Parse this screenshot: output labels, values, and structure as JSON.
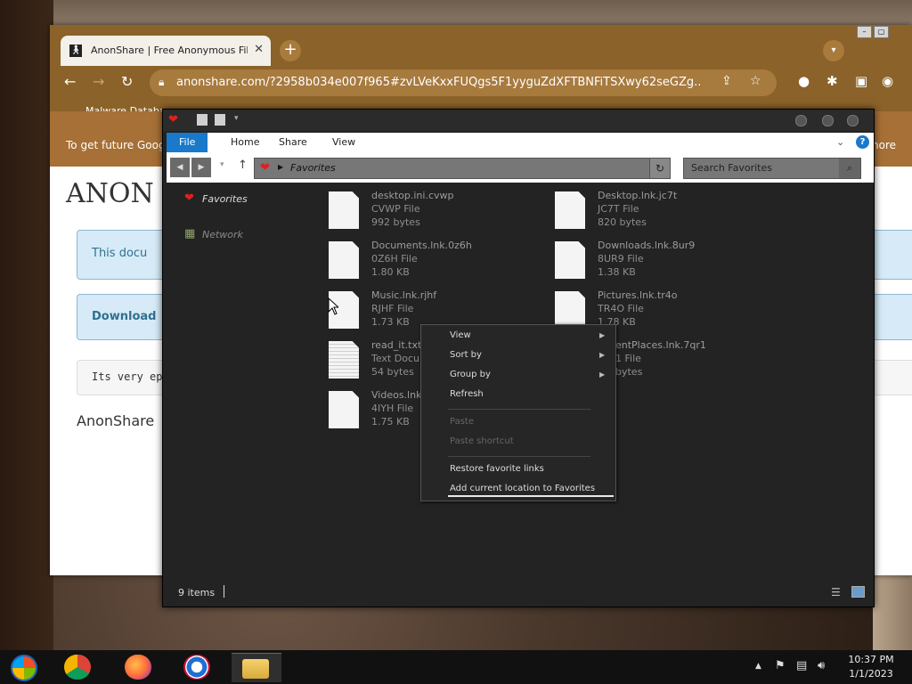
{
  "chrome": {
    "tab_title": "AnonShare | Free Anonymous File Sharing",
    "url": "anonshare.com/?2958b034e007f965#zvLVeKxxFUQgs5F1yyguZdXFTBNFiTSXwy62seGZg...",
    "bookmark_label": "Malware Databas",
    "banner_left": "To get future Goog",
    "banner_right": "more"
  },
  "page": {
    "logo": "ANON",
    "panel1_text": "This docu",
    "panel2_text": "Download",
    "panel3_text": "Its very ep",
    "footer_text": "AnonShare"
  },
  "explorer": {
    "ribbon_tabs": [
      "File",
      "Home",
      "Share",
      "View"
    ],
    "address": "Favorites",
    "search_placeholder": "Search Favorites",
    "nav": [
      {
        "label": "Favorites",
        "icon": "heart-icon"
      },
      {
        "label": "Network",
        "icon": "network-icon"
      }
    ],
    "files": [
      {
        "name": "desktop.ini.cvwp",
        "type": "CVWP File",
        "size": "992 bytes"
      },
      {
        "name": "Desktop.lnk.jc7t",
        "type": "JC7T File",
        "size": "820 bytes"
      },
      {
        "name": "Documents.lnk.0z6h",
        "type": "0Z6H File",
        "size": "1.80 KB"
      },
      {
        "name": "Downloads.lnk.8ur9",
        "type": "8UR9 File",
        "size": "1.38 KB"
      },
      {
        "name": "Music.lnk.rjhf",
        "type": "RJHF File",
        "size": "1.73 KB"
      },
      {
        "name": "Pictures.lnk.tr4o",
        "type": "TR4O File",
        "size": "1.78 KB"
      },
      {
        "name": "read_it.txt",
        "type": "Text Docum",
        "size": "54 bytes"
      },
      {
        "name": "entPlaces.lnk.7qr1",
        "type": "1 File",
        "size": "bytes"
      },
      {
        "name": "Videos.lnk",
        "type": "4IYH File",
        "size": "1.75 KB"
      }
    ],
    "status_count": "9 items"
  },
  "context_menu": {
    "items": [
      {
        "label": "View",
        "submenu": true,
        "disabled": false
      },
      {
        "label": "Sort by",
        "submenu": true,
        "disabled": false
      },
      {
        "label": "Group by",
        "submenu": true,
        "disabled": false
      },
      {
        "label": "Refresh",
        "submenu": false,
        "disabled": false
      },
      {
        "label": "Paste",
        "submenu": false,
        "disabled": true
      },
      {
        "label": "Paste shortcut",
        "submenu": false,
        "disabled": true
      },
      {
        "label": "Restore favorite links",
        "submenu": false,
        "disabled": false
      },
      {
        "label": "Add current location to Favorites",
        "submenu": false,
        "disabled": false
      }
    ]
  },
  "taskbar": {
    "apps": [
      "start-orb",
      "chrome",
      "firefox",
      "internet-explorer",
      "file-explorer"
    ],
    "time": "10:37 PM",
    "date": "1/1/2023"
  },
  "colors": {
    "chrome_frame": "#8b6229",
    "explorer_bg": "#232323",
    "ribbon_accent": "#1979ca",
    "favorites_heart": "#e02020"
  }
}
